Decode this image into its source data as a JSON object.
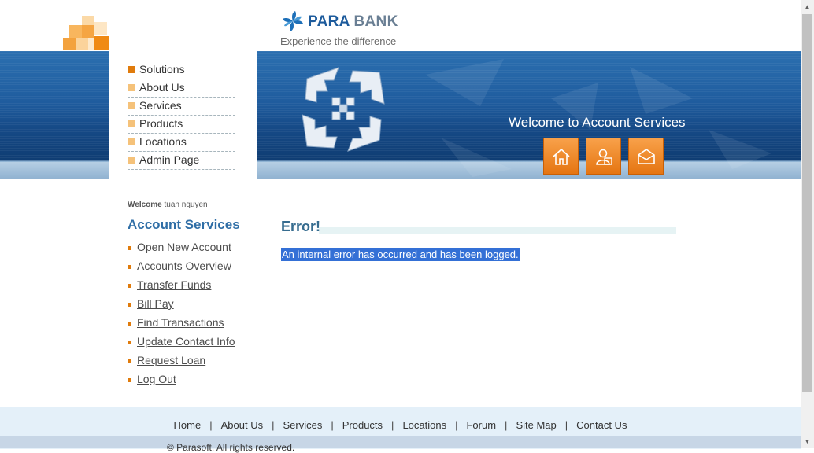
{
  "header": {
    "brand_para": "PARA",
    "brand_bank": "BANK",
    "tagline": "Experience the difference"
  },
  "menu": {
    "items": [
      {
        "label": "Solutions"
      },
      {
        "label": "About Us"
      },
      {
        "label": "Services"
      },
      {
        "label": "Products"
      },
      {
        "label": "Locations"
      },
      {
        "label": "Admin Page"
      }
    ]
  },
  "banner": {
    "welcome_text": "Welcome to Account Services",
    "icons": [
      "home-icon",
      "contact-icon",
      "mail-icon"
    ]
  },
  "sidebar": {
    "welcome_label": "Welcome",
    "user_name": "tuan nguyen",
    "title": "Account Services",
    "links": [
      {
        "label": "Open New Account"
      },
      {
        "label": "Accounts Overview"
      },
      {
        "label": "Transfer Funds"
      },
      {
        "label": "Bill Pay"
      },
      {
        "label": "Find Transactions"
      },
      {
        "label": "Update Contact Info"
      },
      {
        "label": "Request Loan"
      },
      {
        "label": "Log Out"
      }
    ]
  },
  "main": {
    "title": "Error!",
    "message": "An internal error has occurred and has been logged."
  },
  "footer": {
    "links": [
      {
        "label": "Home"
      },
      {
        "label": "About Us"
      },
      {
        "label": "Services"
      },
      {
        "label": "Products"
      },
      {
        "label": "Locations"
      },
      {
        "label": "Forum"
      },
      {
        "label": "Site Map"
      },
      {
        "label": "Contact Us"
      }
    ],
    "separator": "|",
    "copyright": "© Parasoft. All rights reserved."
  },
  "colors": {
    "brand_blue": "#1d5b9c",
    "accent_orange": "#e07b0c",
    "link_blue": "#2f6ea6",
    "selection_blue": "#3470d6"
  }
}
